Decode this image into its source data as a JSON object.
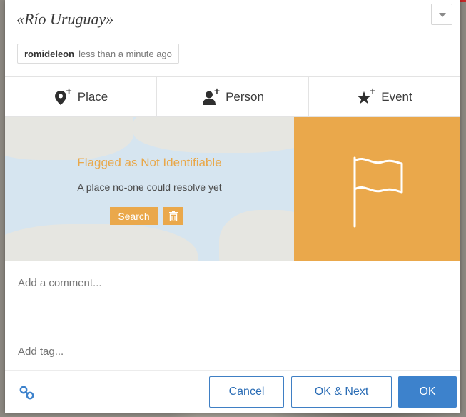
{
  "annotation": {
    "title": "«Río Uruguay»",
    "creator": "romideleon",
    "created_ago": "less than a minute ago"
  },
  "tabs": [
    {
      "label": "Place",
      "icon": "map-pin-plus-icon"
    },
    {
      "label": "Person",
      "icon": "user-plus-icon"
    },
    {
      "label": "Event",
      "icon": "star-plus-icon"
    }
  ],
  "place": {
    "status": "Flagged as Not Identifiable",
    "message": "A place no-one could resolve yet",
    "search_label": "Search",
    "delete_icon": "trash-icon",
    "flag_icon": "flag-icon"
  },
  "comment": {
    "placeholder": "Add a comment..."
  },
  "tags": {
    "placeholder": "Add tag..."
  },
  "footer": {
    "link_icon": "link-icon",
    "cancel_label": "Cancel",
    "ok_next_label": "OK & Next",
    "ok_label": "OK"
  },
  "colors": {
    "accent_orange": "#eaa84b",
    "primary_blue": "#3d82cc",
    "map_water": "#d6e5f0"
  }
}
